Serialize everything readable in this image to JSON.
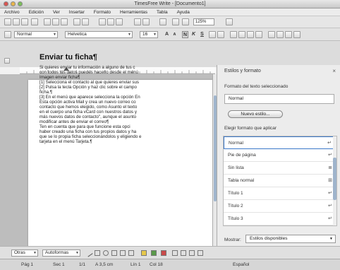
{
  "window": {
    "title": "TimesFree Write - [Documento1]"
  },
  "menu": [
    "Archivo",
    "Edición",
    "Ver",
    "Insertar",
    "Formato",
    "Herramientas",
    "Tabla",
    "Ayuda"
  ],
  "toolbar": {
    "zoom": "125%"
  },
  "format_bar": {
    "style": "Normal",
    "font": "Helvetica",
    "size": "16",
    "buttons": [
      "A",
      "A",
      "N",
      "K",
      "S"
    ]
  },
  "document": {
    "heading": "Enviar tu ficha¶",
    "body": "Si quieres enviar tu información a alguno de tus c\ncon todos tus datos puedes hacerlo desde el menú\nImagen enviar ficha¶\n[1] Selecciona el contacto al que quieres enviar sus\n[2] Pulsa la tecla Opción y haz clic sobre el campo\nficha.¶\n[3] En el menú que aparece selecciona la opción En\nEsta opción activa Mail y crea un nuevo correo co\ncontacto que hemos elegido, como Asunto el texto\nen el cuerpo una ficha vCard con nuestros datos y\nmás nuevos datos de contacto\", aunque el asunto\nmodificar antes de enviar el correo¶\nTen en cuenta que para que funcione esta opci\nhaber creado una ficha con tus propios datos y ha\nque se lo propia ficha seleccionándolos y eligiendo e\ntarjeta en el menú Tarjeta.¶"
  },
  "styles_panel": {
    "title": "Estilos y formato",
    "close": "×",
    "current_label": "Formato del texto seleccionado",
    "current_style": "Normal",
    "new_style_button": "Nuevo estilo...",
    "apply_label": "Elegir formato que aplicar",
    "list": [
      {
        "name": "Normal",
        "mark": "↵",
        "selected": true
      },
      {
        "name": "Pie de página",
        "mark": "↵"
      },
      {
        "name": "Sin lista",
        "mark": "≣"
      },
      {
        "name": "Tabla normal",
        "mark": "⊞"
      },
      {
        "name": "Título 1",
        "mark": "↵"
      },
      {
        "name": "Título 2",
        "mark": "↵"
      },
      {
        "name": "Título 3",
        "mark": "↵"
      }
    ],
    "show_label": "Mostrar:",
    "show_value": "Estilos disponibles"
  },
  "drawing_bar": {
    "shapes": "Otras",
    "autoshapes": "Autoformas"
  },
  "status": {
    "page": "Pág 1",
    "section": "Sec 1",
    "pages": "1/1",
    "position": "A 3,5 cm",
    "line": "Lín 1",
    "column": "Col 18",
    "language": "Español"
  }
}
